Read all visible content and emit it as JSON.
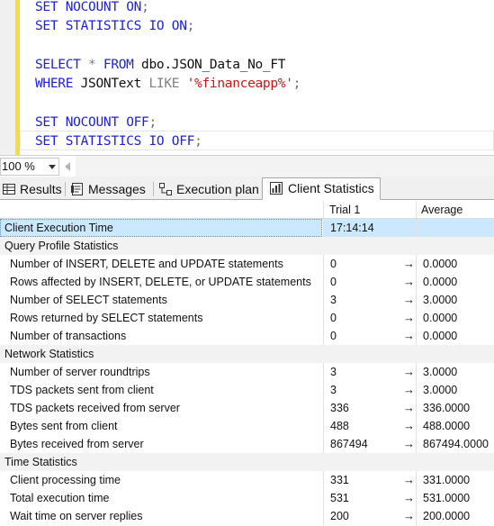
{
  "editor": {
    "lines": [
      {
        "parts": [
          [
            "kw",
            "SET "
          ],
          [
            "kw",
            "NOCOUNT "
          ],
          [
            "kw",
            "ON"
          ],
          [
            "punct",
            ";"
          ]
        ]
      },
      {
        "parts": [
          [
            "kw",
            "SET "
          ],
          [
            "kw",
            "STATISTICS "
          ],
          [
            "kw",
            "IO "
          ],
          [
            "kw",
            "ON"
          ],
          [
            "punct",
            ";"
          ]
        ]
      },
      {
        "parts": []
      },
      {
        "parts": [
          [
            "kw",
            "SELECT "
          ],
          [
            "op",
            "* "
          ],
          [
            "kw",
            "FROM "
          ],
          [
            "ident",
            "dbo.JSON_Data_No_FT"
          ]
        ]
      },
      {
        "parts": [
          [
            "kw",
            "WHERE "
          ],
          [
            "ident",
            "JSONText "
          ],
          [
            "op",
            "LIKE "
          ],
          [
            "str",
            "'%financeapp%'"
          ],
          [
            "punct",
            ";"
          ]
        ]
      },
      {
        "parts": []
      },
      {
        "parts": [
          [
            "kw",
            "SET "
          ],
          [
            "kw",
            "NOCOUNT "
          ],
          [
            "kw",
            "OFF"
          ],
          [
            "punct",
            ";"
          ]
        ]
      },
      {
        "parts": [
          [
            "kw",
            "SET "
          ],
          [
            "kw",
            "STATISTICS "
          ],
          [
            "kw",
            "IO "
          ],
          [
            "kw",
            "OFF"
          ],
          [
            "punct",
            ";"
          ]
        ]
      }
    ]
  },
  "zoom": {
    "value": "100 %"
  },
  "tabs": [
    {
      "label": "Results",
      "icon": "grid-icon",
      "active": false
    },
    {
      "label": "Messages",
      "icon": "messages-icon",
      "active": false
    },
    {
      "label": "Execution plan",
      "icon": "execution-plan-icon",
      "active": false
    },
    {
      "label": "Client Statistics",
      "icon": "client-statistics-icon",
      "active": true
    }
  ],
  "grid": {
    "headers": {
      "trial": "Trial  1",
      "average": "Average"
    },
    "arrow": "→",
    "rows": [
      {
        "type": "selected",
        "label": "Client Execution Time",
        "trial": "17:14:14",
        "avg": ""
      },
      {
        "type": "section",
        "label": "Query Profile Statistics"
      },
      {
        "type": "data",
        "label": "Number of INSERT, DELETE and UPDATE statements",
        "trial": "0",
        "avg": "0.0000"
      },
      {
        "type": "data",
        "label": "Rows affected by INSERT, DELETE, or UPDATE statements",
        "trial": "0",
        "avg": "0.0000"
      },
      {
        "type": "data",
        "label": "Number of SELECT statements",
        "trial": "3",
        "avg": "3.0000"
      },
      {
        "type": "data",
        "label": "Rows returned by SELECT statements",
        "trial": "0",
        "avg": "0.0000"
      },
      {
        "type": "data",
        "label": "Number of transactions",
        "trial": "0",
        "avg": "0.0000"
      },
      {
        "type": "section",
        "label": "Network Statistics"
      },
      {
        "type": "data",
        "label": "Number of server roundtrips",
        "trial": "3",
        "avg": "3.0000"
      },
      {
        "type": "data",
        "label": "TDS packets sent from client",
        "trial": "3",
        "avg": "3.0000"
      },
      {
        "type": "data",
        "label": "TDS packets received from server",
        "trial": "336",
        "avg": "336.0000"
      },
      {
        "type": "data",
        "label": "Bytes sent from client",
        "trial": "488",
        "avg": "488.0000"
      },
      {
        "type": "data",
        "label": "Bytes received from server",
        "trial": "867494",
        "avg": "867494.0000"
      },
      {
        "type": "section",
        "label": "Time Statistics"
      },
      {
        "type": "data",
        "label": "Client processing time",
        "trial": "331",
        "avg": "331.0000"
      },
      {
        "type": "data",
        "label": "Total execution time",
        "trial": "531",
        "avg": "531.0000"
      },
      {
        "type": "data",
        "label": "Wait time on server replies",
        "trial": "200",
        "avg": "200.0000"
      }
    ]
  }
}
